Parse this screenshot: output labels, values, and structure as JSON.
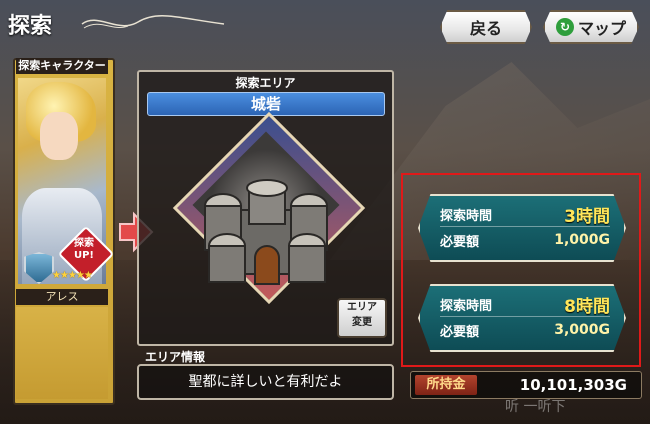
{
  "header": {
    "title": "探索",
    "back_label": "戻る",
    "map_label": "マップ"
  },
  "character": {
    "panel_label": "探索キャラクター",
    "name": "アレス",
    "badge_text": "探索UP!",
    "stars": "★★★★★"
  },
  "area": {
    "section_label": "探索エリア",
    "name": "城砦",
    "change_label_line1": "エリア",
    "change_label_line2": "変更",
    "info_label": "エリア情報",
    "info_text": "聖都に詳しいと有利だよ"
  },
  "options": [
    {
      "time_label": "探索時間",
      "time_value": "3時間",
      "cost_label": "必要額",
      "cost_value": "1,000G"
    },
    {
      "time_label": "探索時間",
      "time_value": "8時間",
      "cost_label": "必要額",
      "cost_value": "3,000G"
    }
  ],
  "wallet": {
    "label": "所持金",
    "value": "10,101,303G"
  },
  "watermark": "听 一听下",
  "colors": {
    "highlight_frame": "#e01919",
    "option_bg": "#0e4c55",
    "time_text": "#ffe65a",
    "area_name_bg": "#2c64b4"
  }
}
